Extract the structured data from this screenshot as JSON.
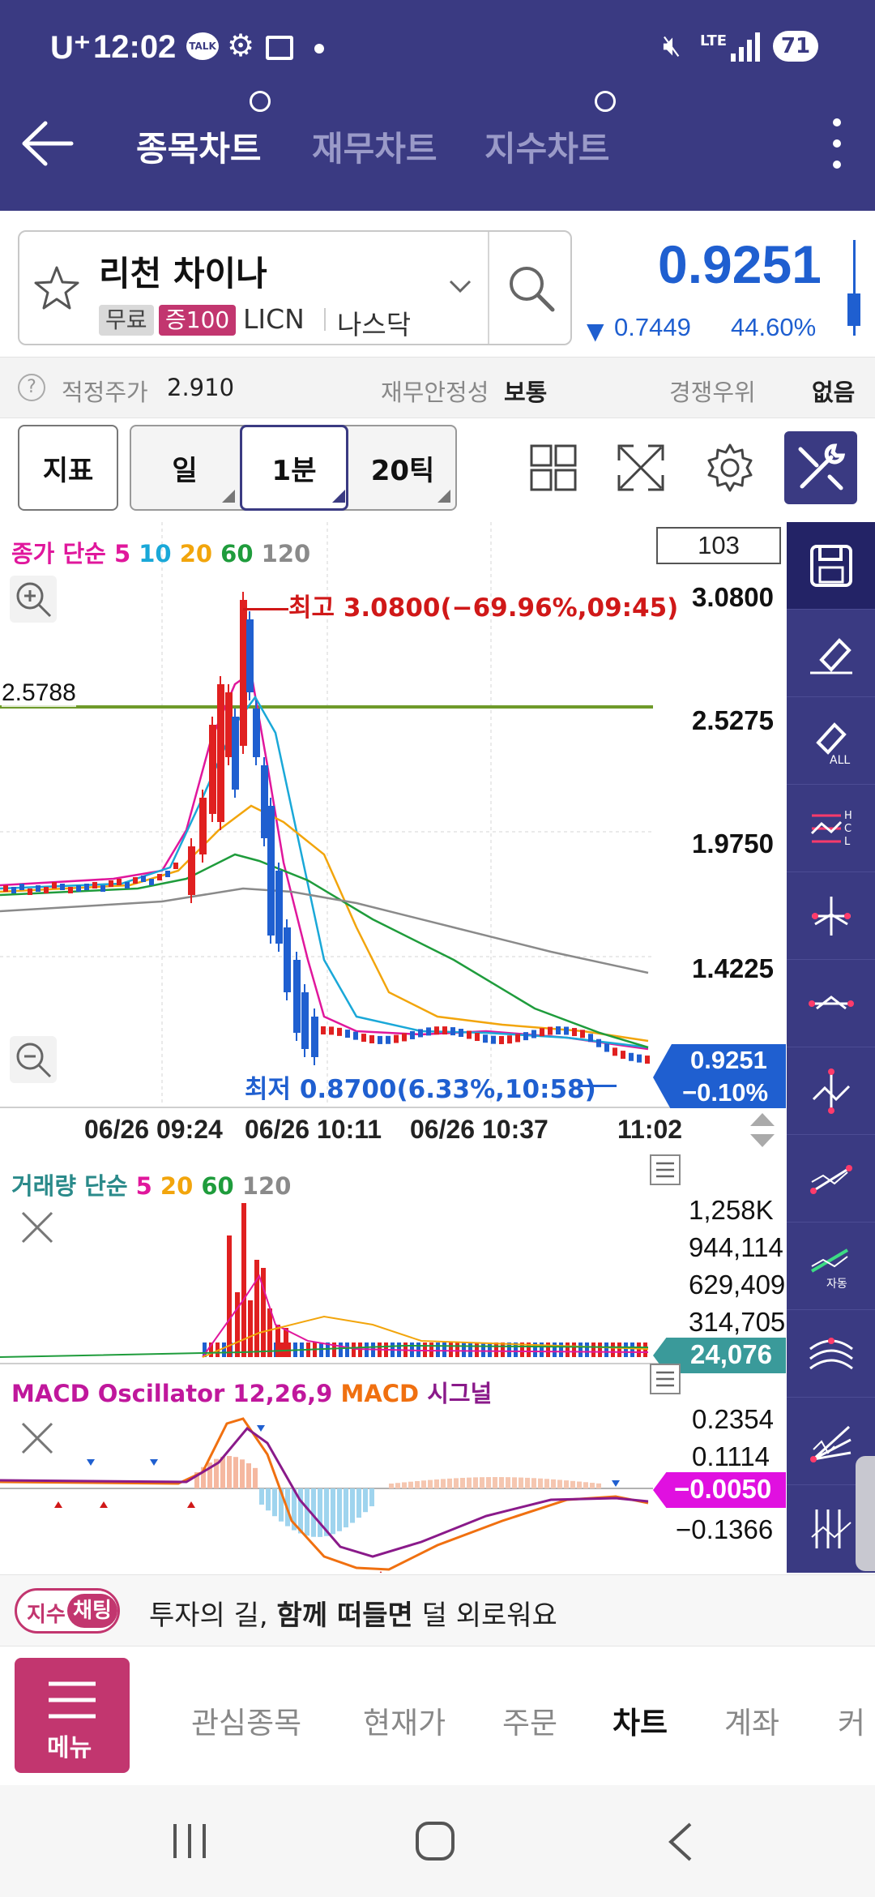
{
  "status_bar": {
    "carrier": "U⁺",
    "time": "12:02",
    "talk_icon_text": "TALK",
    "network": "LTE",
    "battery": "71"
  },
  "header": {
    "tabs": [
      "종목차트",
      "재무차트",
      "지수차트"
    ],
    "active_tab": 0
  },
  "stock": {
    "name": "리천 차이나",
    "badges": [
      "무료",
      "증100"
    ],
    "ticker": "LICN",
    "market": "나스닥",
    "price": "0.9251",
    "change": "0.7449",
    "change_pct": "44.60%"
  },
  "infobar": {
    "fair_price_label": "적정주가",
    "fair_price_value": "2.910",
    "stability_label": "재무안정성",
    "stability_value": "보통",
    "competition_label": "경쟁우위",
    "competition_value": "없음"
  },
  "toolbar": {
    "indicator": "지표",
    "period_day": "일",
    "period_min": "1분",
    "period_tick": "20틱"
  },
  "chart": {
    "ma_label": "종가 단순",
    "ma_periods": [
      "5",
      "10",
      "20",
      "60",
      "120"
    ],
    "ma_colors": [
      "#e0179c",
      "#1aa8d8",
      "#f2a50c",
      "#1f9c3c",
      "#8a8a8a"
    ],
    "count_box": "103",
    "price_axis": [
      "3.0800",
      "2.5275",
      "1.9750",
      "1.4225"
    ],
    "hline_value": "2.5788",
    "high_note": "최고 3.0800(−69.96%,09:45)",
    "low_note": "최저 0.8700(6.33%,10:58)",
    "current_price": "0.9251",
    "current_change": "−0.10%",
    "time_axis": [
      "06/26 09:24",
      "06/26 10:11",
      "06/26 10:37",
      "11:02"
    ]
  },
  "volume": {
    "label": "거래량 단순",
    "periods": [
      "5",
      "20",
      "60",
      "120"
    ],
    "axis": [
      "1,258K",
      "944,114",
      "629,409",
      "314,705"
    ],
    "current": "24,076"
  },
  "macd": {
    "title": "MACD Oscillator 12,26,9",
    "macd_label": "MACD",
    "signal_label": "시그널",
    "axis": [
      "0.2354",
      "0.1114",
      "−0.1366"
    ],
    "current": "−0.0050"
  },
  "banner": {
    "tag1": "지수",
    "tag2": "채팅",
    "text_pre": "투자의 길, ",
    "text_bold": "함께 떠들면",
    "text_post": " 덜 외로워요"
  },
  "bottom_nav": {
    "menu": "메뉴",
    "items": [
      "관심종목",
      "현재가",
      "주문",
      "차트",
      "계좌",
      "커"
    ],
    "active": "차트"
  },
  "colors": {
    "header_bg": "#3a3a82",
    "up": "#e02020",
    "down": "#1f5fd0",
    "accent": "#c2366f"
  }
}
